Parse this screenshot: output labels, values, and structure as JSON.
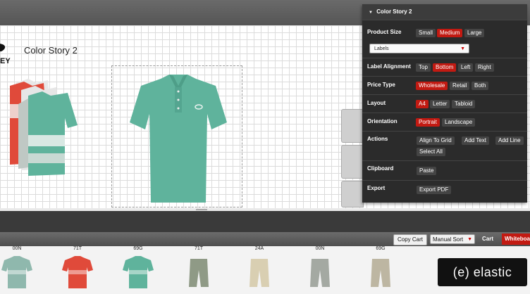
{
  "page": {
    "title": "Color Story 2"
  },
  "panel": {
    "title": "Color Story 2",
    "product_size": {
      "label": "Product Size",
      "options": [
        "Small",
        "Medium",
        "Large"
      ],
      "selected": "Medium"
    },
    "labels_select": {
      "value": "Labels"
    },
    "label_alignment": {
      "label": "Label Alignment",
      "options": [
        "Top",
        "Bottom",
        "Left",
        "Right"
      ],
      "selected": "Bottom"
    },
    "price_type": {
      "label": "Price Type",
      "options": [
        "Wholesale",
        "Retail",
        "Both"
      ],
      "selected": "Wholesale"
    },
    "layout": {
      "label": "Layout",
      "options": [
        "A4",
        "Letter",
        "Tabloid"
      ],
      "selected": "A4"
    },
    "orientation": {
      "label": "Orientation",
      "options": [
        "Portrait",
        "Landscape"
      ],
      "selected": "Portrait"
    },
    "actions": {
      "label": "Actions",
      "options": [
        "Align To Grid",
        "Add Text",
        "Add Line",
        "Select All"
      ]
    },
    "clipboard": {
      "label": "Clipboard",
      "options": [
        "Paste"
      ]
    },
    "export": {
      "label": "Export",
      "options": [
        "Export PDF"
      ]
    }
  },
  "cart_toolbar": {
    "copy_cart": "Copy Cart",
    "sort": "Manual Sort",
    "cart": "Cart",
    "whiteboard": "Whiteboard"
  },
  "products": [
    {
      "code": "00N",
      "color": "#8fb8ad",
      "kind": "shirt"
    },
    {
      "code": "71T",
      "color": "#e04a3a",
      "kind": "shirt"
    },
    {
      "code": "69G",
      "color": "#5fb39c",
      "kind": "shirt"
    },
    {
      "code": "71T",
      "color": "#8f9a86",
      "kind": "shorts"
    },
    {
      "code": "24A",
      "color": "#d9cfb2",
      "kind": "shorts"
    },
    {
      "code": "00N",
      "color": "#a4a9a2",
      "kind": "shorts"
    },
    {
      "code": "69G",
      "color": "#bdb6a2",
      "kind": "shorts"
    }
  ],
  "watermark": "(e) elastic",
  "colors": {
    "accent": "#c21a12",
    "panel_bg": "#2b2b2b",
    "shirt": "#5fb39c"
  }
}
